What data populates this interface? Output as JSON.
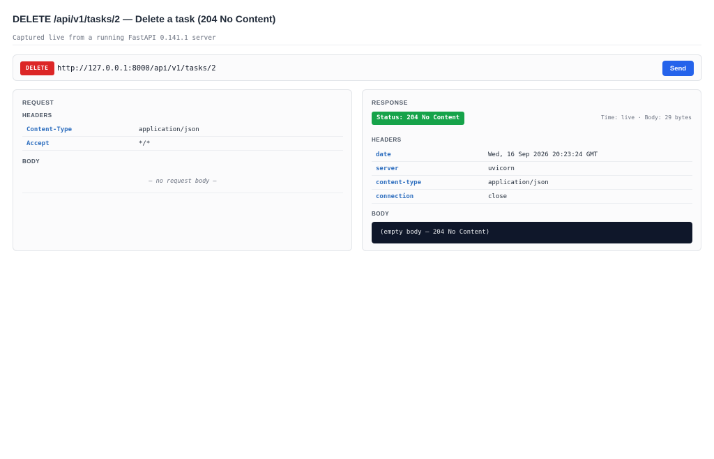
{
  "page": {
    "title": "DELETE /api/v1/tasks/2 — Delete a task (204 No Content)",
    "subtitle": "Captured live from a running FastAPI 0.141.1 server"
  },
  "urlbar": {
    "method": "DELETE",
    "url": "http://127.0.0.1:8000/api/v1/tasks/2",
    "send_label": "Send"
  },
  "request": {
    "title": "REQUEST",
    "headers_label": "HEADERS",
    "headers": [
      {
        "key": "Content-Type",
        "value": "application/json"
      },
      {
        "key": "Accept",
        "value": "*/*"
      }
    ],
    "body_label": "BODY",
    "body_placeholder": "— no request body —"
  },
  "response": {
    "title": "RESPONSE",
    "status": "Status: 204 No Content",
    "meta": "Time: live · Body: 29 bytes",
    "headers_label": "HEADERS",
    "headers": [
      {
        "key": "date",
        "value": "Wed, 16 Sep 2026 20:23:24 GMT"
      },
      {
        "key": "server",
        "value": "uvicorn"
      },
      {
        "key": "content-type",
        "value": "application/json"
      },
      {
        "key": "connection",
        "value": "close"
      }
    ],
    "body_label": "BODY",
    "body": "(empty body — 204 No Content)"
  },
  "colors": {
    "method_delete": "#dc2626",
    "send_button": "#2563eb",
    "status_success": "#16a34a",
    "header_key": "#2f6fbf",
    "code_background": "#0f172a"
  }
}
